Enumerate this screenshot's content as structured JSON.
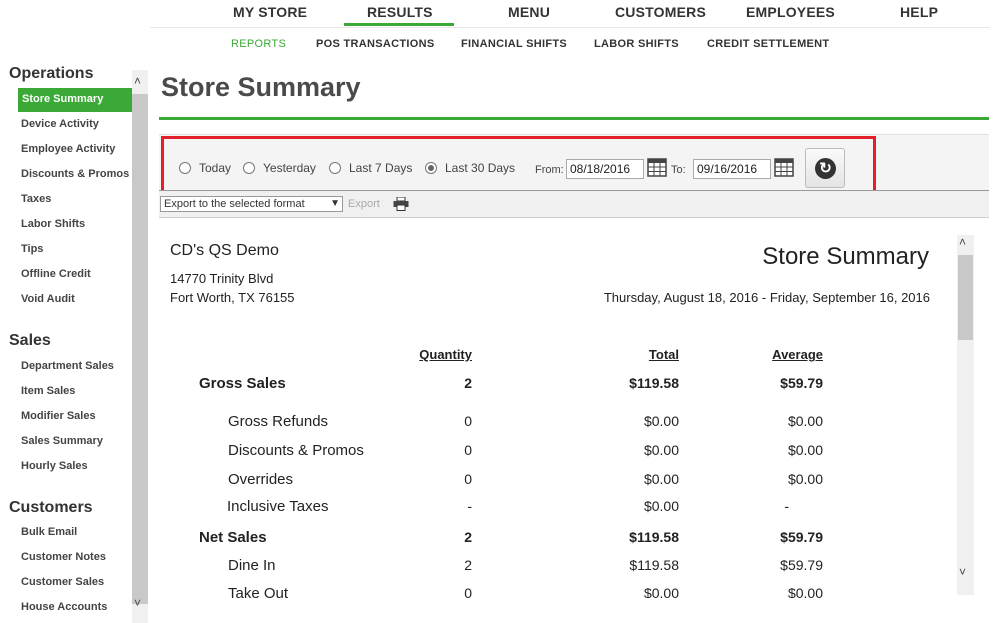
{
  "topnav": {
    "items": [
      "MY STORE",
      "RESULTS",
      "MENU",
      "CUSTOMERS",
      "EMPLOYEES",
      "HELP"
    ],
    "active": "RESULTS"
  },
  "subnav": {
    "items": [
      "REPORTS",
      "POS TRANSACTIONS",
      "FINANCIAL SHIFTS",
      "LABOR SHIFTS",
      "CREDIT SETTLEMENT"
    ],
    "active": "REPORTS"
  },
  "sidebar": {
    "sections": [
      {
        "title": "Operations",
        "items": [
          "Store Summary",
          "Device Activity",
          "Employee Activity",
          "Discounts & Promos",
          "Taxes",
          "Labor Shifts",
          "Tips",
          "Offline Credit",
          "Void Audit"
        ]
      },
      {
        "title": "Sales",
        "items": [
          "Department Sales",
          "Item Sales",
          "Modifier Sales",
          "Sales Summary",
          "Hourly Sales"
        ]
      },
      {
        "title": "Customers",
        "items": [
          "Bulk Email",
          "Customer Notes",
          "Customer Sales",
          "House Accounts"
        ]
      }
    ],
    "active": "Store Summary"
  },
  "page": {
    "title": "Store Summary"
  },
  "filters": {
    "options": [
      "Today",
      "Yesterday",
      "Last 7 Days",
      "Last 30 Days"
    ],
    "selected": "Last 30 Days",
    "from_label": "From:",
    "from_value": "08/18/2016",
    "to_label": "To:",
    "to_value": "09/16/2016"
  },
  "export": {
    "select_value": "Export to the selected format",
    "link_label": "Export"
  },
  "report": {
    "store_name": "CD's QS Demo",
    "address_line1": "14770 Trinity Blvd",
    "address_line2": "Fort Worth, TX 76155",
    "title": "Store Summary",
    "date_range": "Thursday, August 18, 2016 - Friday, September 16, 2016",
    "columns": [
      "Quantity",
      "Total",
      "Average"
    ],
    "rows": [
      {
        "label": "Gross Sales",
        "qty": "2",
        "total": "$119.58",
        "avg": "$59.79",
        "bold": true
      },
      {
        "label": "Gross Refunds",
        "qty": "0",
        "total": "$0.00",
        "avg": "$0.00"
      },
      {
        "label": "Discounts & Promos",
        "qty": "0",
        "total": "$0.00",
        "avg": "$0.00"
      },
      {
        "label": "Overrides",
        "qty": "0",
        "total": "$0.00",
        "avg": "$0.00"
      },
      {
        "label": "Inclusive Taxes",
        "qty": "-",
        "total": "$0.00",
        "avg": "-"
      },
      {
        "label": "Net Sales",
        "qty": "2",
        "total": "$119.58",
        "avg": "$59.79",
        "bold": true
      },
      {
        "label": "Dine In",
        "qty": "2",
        "total": "$119.58",
        "avg": "$59.79"
      },
      {
        "label": "Take Out",
        "qty": "0",
        "total": "$0.00",
        "avg": "$0.00"
      }
    ]
  },
  "colors": {
    "accent": "#3aa935",
    "highlight_box": "#e3202a"
  }
}
